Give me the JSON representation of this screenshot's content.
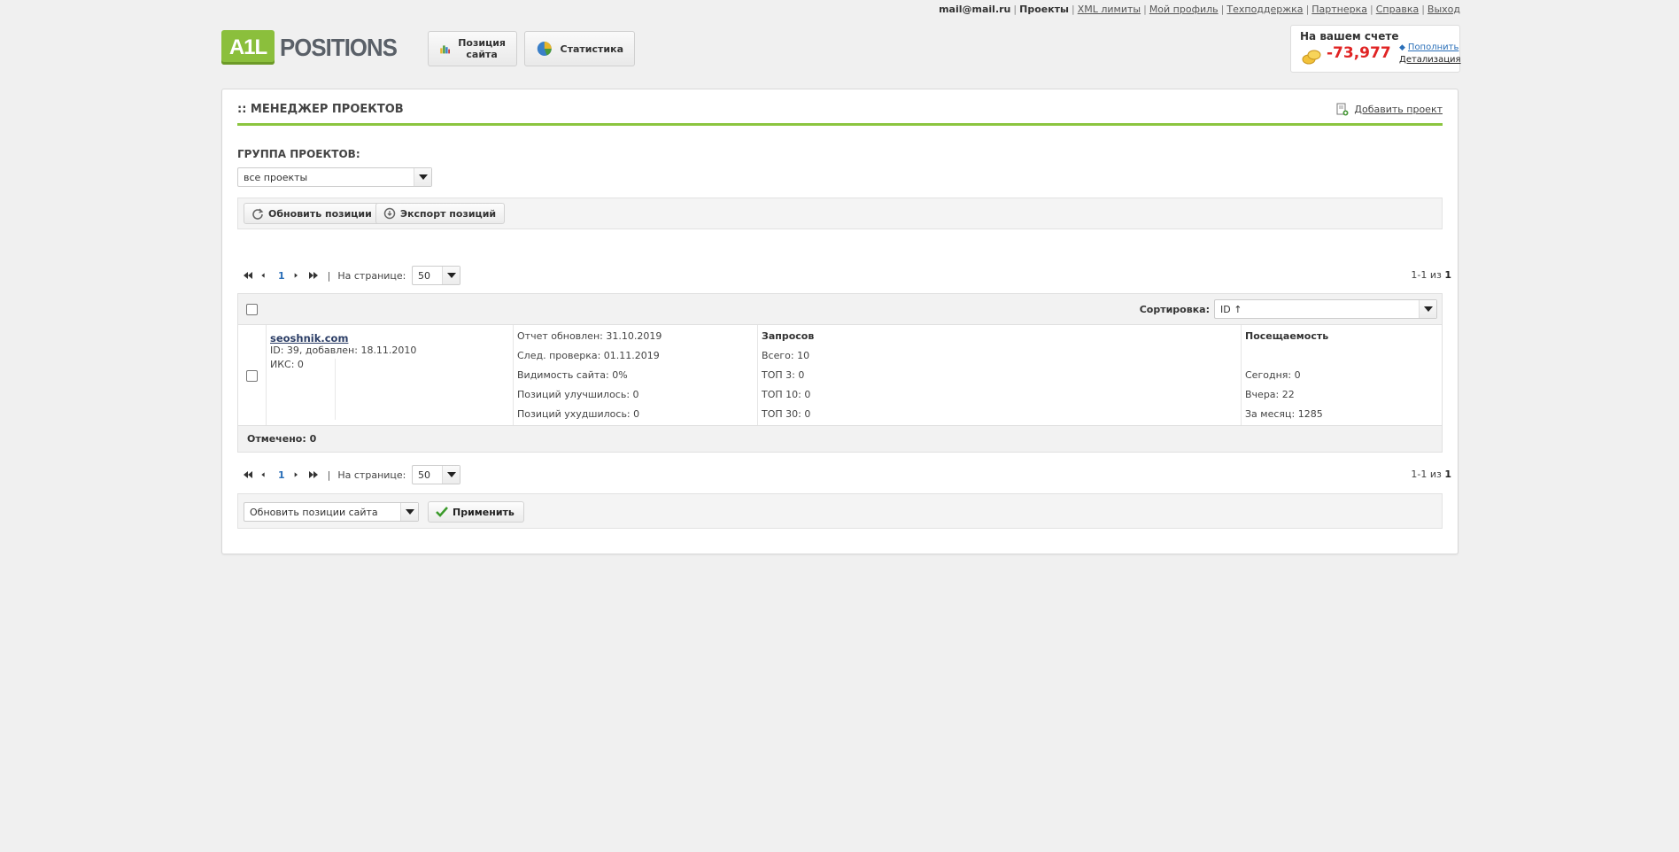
{
  "top_nav": {
    "email": "mail@mail.ru",
    "projects": "Проекты",
    "xml_limits": "XML лимиты",
    "profile": "Мой профиль",
    "support": "Техподдержка",
    "partner": "Партнерка",
    "help": "Справка",
    "logout": "Выход"
  },
  "logo": {
    "mark": "A1L",
    "text": "POSITIONS"
  },
  "nav_buttons": {
    "positions_line1": "Позиция",
    "positions_line2": "сайта",
    "statistics": "Статистика"
  },
  "balance": {
    "title": "На вашем счете",
    "amount": "-73,977",
    "topup": "Пополнить",
    "details": "Детализация"
  },
  "panel": {
    "title": ":: МЕНЕДЖЕР ПРОЕКТОВ",
    "add_project": "Добавить проект",
    "group_label": "ГРУППА ПРОЕКТОВ:",
    "group_select": "все проекты",
    "update_positions": "Обновить позиции",
    "export_positions": "Экспорт позиций"
  },
  "pagination": {
    "page": "1",
    "per_page_label": "На странице:",
    "per_page": "50",
    "count_prefix": "1-1 из",
    "count_total": "1"
  },
  "table": {
    "sort_label": "Сортировка:",
    "sort_value": "ID ↑",
    "marked": "Отмечено: 0",
    "project": {
      "site": "seoshnik.com",
      "meta": "ID: 39, добавлен: 18.11.2010",
      "iks": "ИКС: 0",
      "report": "Отчет обновлен: 31.10.2019",
      "next_check": "След. проверка: 01.11.2019",
      "visibility": "Видимость сайта: 0%",
      "improved": "Позиций улучшилось: 0",
      "worsened": "Позиций ухудшилось: 0",
      "queries_title": "Запросов",
      "queries_total": "Всего: 10",
      "top3": "ТОП 3: 0",
      "top10": "ТОП 10: 0",
      "top30": "ТОП 30: 0",
      "traffic_title": "Посещаемость",
      "today": "Сегодня: 0",
      "yesterday": "Вчера: 22",
      "month": "За месяц: 1285"
    }
  },
  "bulk": {
    "action_select": "Обновить позиции сайта",
    "apply": "Применить"
  },
  "colors": {
    "accent_green": "#8bc53f",
    "balance_red": "#e02424",
    "link_blue": "#2a6fb8"
  }
}
